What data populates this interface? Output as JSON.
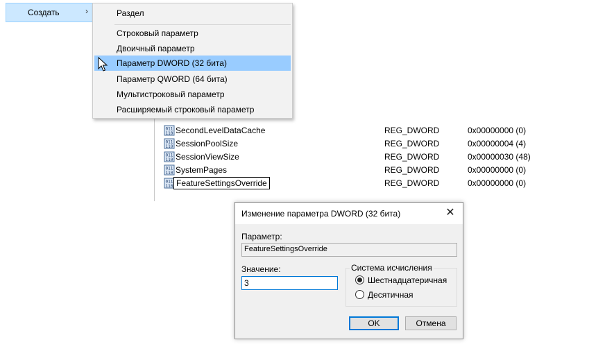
{
  "context_menu": {
    "parent_item": {
      "label": "Создать",
      "arrow": "›"
    },
    "submenu": {
      "items": [
        {
          "label": "Раздел"
        },
        {
          "label": "Строковый параметр"
        },
        {
          "label": "Двоичный параметр"
        },
        {
          "label": "Параметр DWORD (32 бита)",
          "highlighted": true
        },
        {
          "label": "Параметр QWORD (64 бита)"
        },
        {
          "label": "Мультистроковый параметр"
        },
        {
          "label": "Расширяемый строковый параметр"
        }
      ]
    }
  },
  "registry_values": [
    {
      "name": "SecondLevelDataCache",
      "type": "REG_DWORD",
      "data": "0x00000000 (0)"
    },
    {
      "name": "SessionPoolSize",
      "type": "REG_DWORD",
      "data": "0x00000004 (4)"
    },
    {
      "name": "SessionViewSize",
      "type": "REG_DWORD",
      "data": "0x00000030 (48)"
    },
    {
      "name": "SystemPages",
      "type": "REG_DWORD",
      "data": "0x00000000 (0)"
    },
    {
      "name": "FeatureSettingsOverride",
      "type": "REG_DWORD",
      "data": "0x00000000 (0)",
      "editing": true
    }
  ],
  "dialog": {
    "title": "Изменение параметра DWORD (32 бита)",
    "close_glyph": "✕",
    "param_label": "Параметр:",
    "param_value": "FeatureSettingsOverride",
    "value_label": "Значение:",
    "value": "3",
    "base_group": {
      "title": "Система исчисления",
      "options": [
        {
          "label": "Шестнадцатеричная",
          "selected": true
        },
        {
          "label": "Десятичная",
          "selected": false
        }
      ]
    },
    "ok_label": "OK",
    "cancel_label": "Отмена"
  },
  "colors": {
    "menu_highlight": "#99ccff",
    "parent_highlight": "#cce8ff",
    "focus_border": "#0078d7"
  },
  "icons": {
    "registry_value": "reg-dword-icon",
    "cursor": "mouse-pointer-icon"
  }
}
